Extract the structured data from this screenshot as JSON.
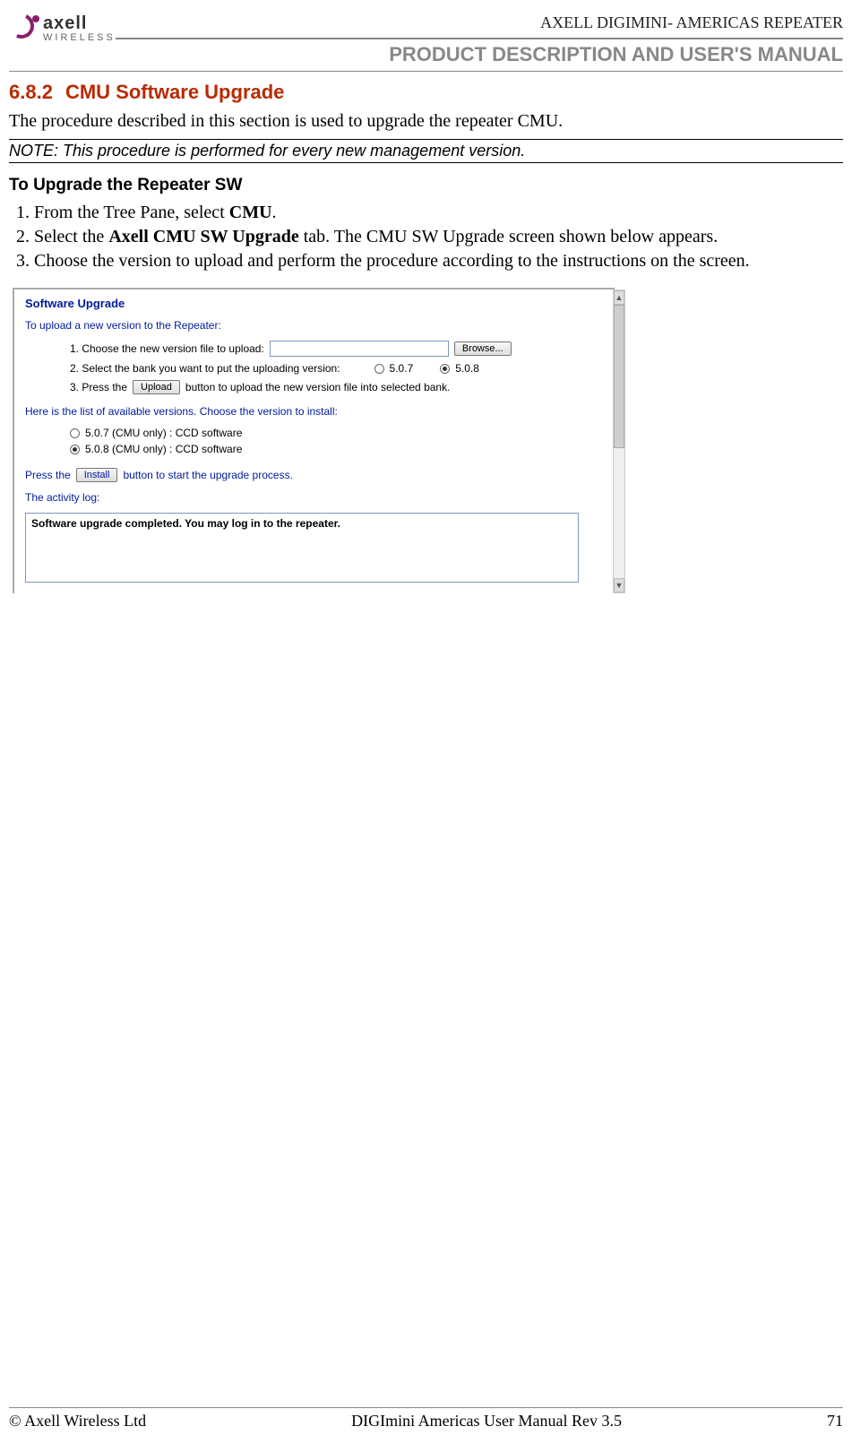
{
  "header": {
    "logo_brand": "axell",
    "logo_sub": "WIRELESS",
    "doc_title": "AXELL DIGIMINI- AMERICAS REPEATER",
    "doc_subtitle": "PRODUCT DESCRIPTION AND USER'S MANUAL"
  },
  "section": {
    "number": "6.8.2",
    "title": "CMU Software Upgrade",
    "intro": "The procedure described in this section is used to upgrade the repeater CMU.",
    "note": "NOTE: This procedure is performed for every new management version.",
    "sub_heading": "To Upgrade the Repeater SW",
    "steps": [
      {
        "pre": "From the Tree Pane, select ",
        "bold": "CMU",
        "post": "."
      },
      {
        "pre": "Select the ",
        "bold": "Axell CMU SW Upgrade",
        "post": " tab. The CMU SW Upgrade screen shown below appears."
      },
      {
        "pre": "Choose the version to upload and perform the procedure according to the instructions on the screen.",
        "bold": "",
        "post": ""
      }
    ]
  },
  "screenshot": {
    "title": "Software Upgrade",
    "intro": "To upload a new version to the Repeater:",
    "step1_label": "1. Choose the new version file to upload:",
    "browse_label": "Browse...",
    "step2_label": "2. Select the bank you want to put the uploading version:",
    "bank_options": [
      {
        "label": "5.0.7",
        "checked": false
      },
      {
        "label": "5.0.8",
        "checked": true
      }
    ],
    "step3_pre": "3. Press the",
    "upload_label": "Upload",
    "step3_post": "button to upload the new version file into selected bank.",
    "avail_heading": "Here is the list of available versions. Choose the version to install:",
    "versions": [
      {
        "label": "5.0.7 (CMU only) : CCD software",
        "checked": false
      },
      {
        "label": "5.0.8 (CMU only) : CCD software",
        "checked": true
      }
    ],
    "install_pre": "Press the",
    "install_label": "Install",
    "install_post": "button to start the upgrade process.",
    "activity_label": "The activity log:",
    "log_text": "Software upgrade completed. You may log in to the repeater."
  },
  "footer": {
    "left": "© Axell Wireless Ltd",
    "center": "DIGImini Americas User Manual Rev 3.5",
    "right": "71"
  }
}
